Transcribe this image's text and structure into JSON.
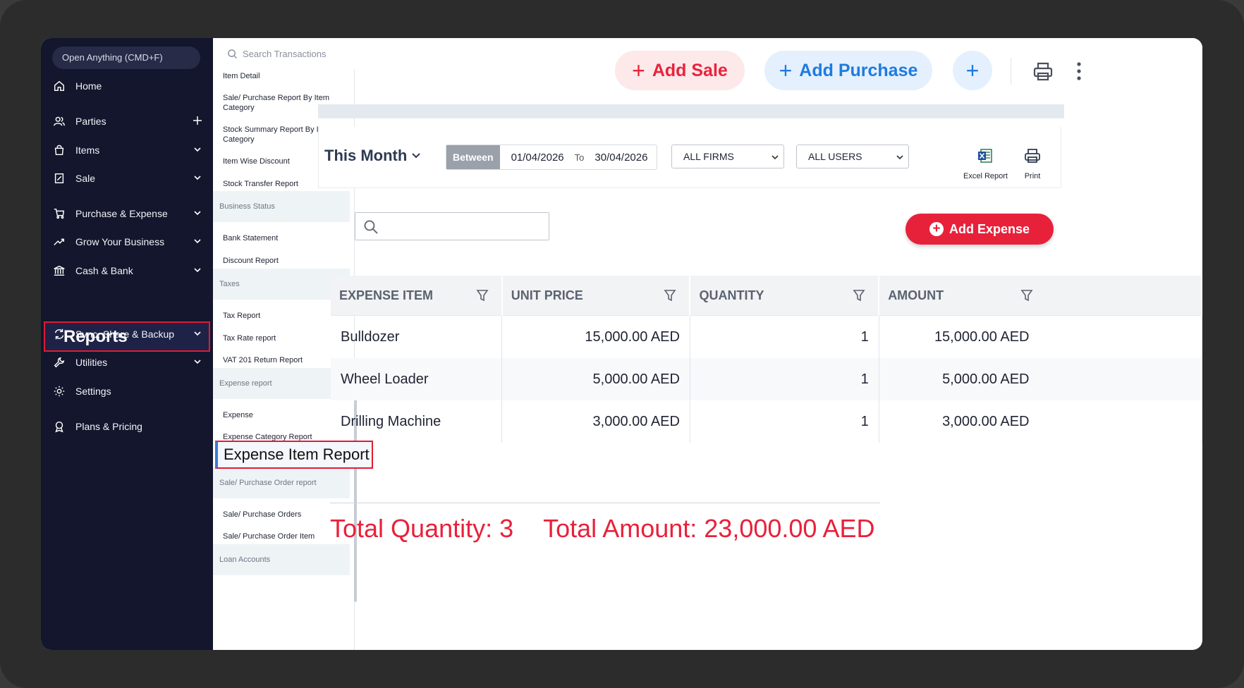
{
  "nav": {
    "open_anything": "Open Anything (CMD+F)",
    "items": [
      {
        "label": "Home",
        "icon": "home-icon"
      },
      {
        "label": "Parties",
        "icon": "users-icon",
        "trail": "plus"
      },
      {
        "label": "Items",
        "icon": "bag-icon",
        "trail": "chevron"
      },
      {
        "label": "Sale",
        "icon": "receipt-icon",
        "trail": "chevron"
      },
      {
        "label": "Purchase & Expense",
        "icon": "cart-icon",
        "trail": "chevron"
      },
      {
        "label": "Grow Your Business",
        "icon": "trend-icon",
        "trail": "chevron"
      },
      {
        "label": "Cash & Bank",
        "icon": "bank-icon",
        "trail": "chevron"
      },
      {
        "label": "Sync, Share & Backup",
        "icon": "sync-icon",
        "trail": "chevron"
      },
      {
        "label": "Utilities",
        "icon": "wrench-icon",
        "trail": "chevron"
      },
      {
        "label": "Settings",
        "icon": "gear-icon"
      },
      {
        "label": "Plans & Pricing",
        "icon": "badge-icon"
      }
    ],
    "reports_label": "Reports"
  },
  "submenu": {
    "search_placeholder": "Search Transactions",
    "items": {
      "item_detail": "Item Detail",
      "sale_purchase_by_category": "Sale/ Purchase Report By Item Category",
      "stock_summary_by_category": "Stock Summary Report By Item Category",
      "item_wise_discount": "Item Wise Discount",
      "stock_transfer": "Stock Transfer Report",
      "bank_statement": "Bank Statement",
      "discount_report": "Discount Report",
      "tax_report": "Tax Report",
      "tax_rate_report": "Tax Rate report",
      "vat_201": "VAT 201 Return Report",
      "expense": "Expense",
      "expense_category": "Expense Category Report",
      "expense_item": "Expense Item Report",
      "sale_purchase_orders": "Sale/ Purchase Orders",
      "sale_purchase_order_item": "Sale/ Purchase Order Item"
    },
    "heads": {
      "business_status": "Business Status",
      "taxes": "Taxes",
      "expense_report": "Expense report",
      "order_report": "Sale/ Purchase Order report",
      "loan_accounts": "Loan Accounts"
    }
  },
  "topbar": {
    "add_sale": "Add Sale",
    "add_purchase": "Add Purchase",
    "plus": "+"
  },
  "filters": {
    "period": "This Month",
    "between_label": "Between",
    "from_date": "01/04/2026",
    "to_label": "To",
    "to_date": "30/04/2026",
    "firms": "ALL FIRMS",
    "users": "ALL USERS",
    "excel_label": "Excel Report",
    "print_label": "Print"
  },
  "content": {
    "add_expense": "Add Expense",
    "columns": [
      "EXPENSE ITEM",
      "UNIT PRICE",
      "QUANTITY",
      "AMOUNT"
    ],
    "rows": [
      {
        "item": "Bulldozer",
        "unit_price": "15,000.00 AED",
        "quantity": "1",
        "amount": "15,000.00 AED"
      },
      {
        "item": "Wheel Loader",
        "unit_price": "5,000.00 AED",
        "quantity": "1",
        "amount": "5,000.00 AED"
      },
      {
        "item": "Drilling Machine",
        "unit_price": "3,000.00 AED",
        "quantity": "1",
        "amount": "3,000.00 AED"
      }
    ],
    "total_quantity": "Total Quantity: 3",
    "total_amount": "Total Amount: 23,000.00 AED"
  },
  "colors": {
    "nav_bg": "#13162c",
    "accent_red": "#e8213b",
    "accent_blue": "#1e7be0"
  }
}
